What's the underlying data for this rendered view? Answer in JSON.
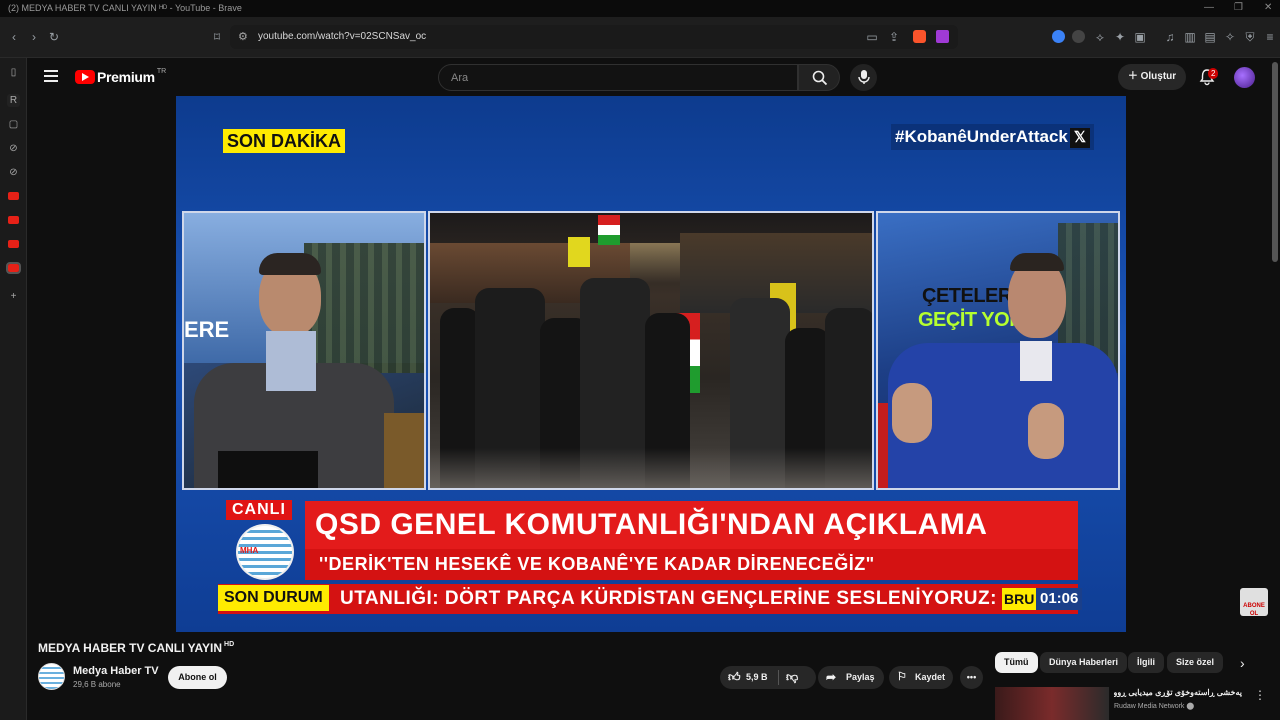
{
  "window": {
    "title": "(2) MEDYA HABER TV CANLI YAYIN ᴴᴰ - YouTube - Brave"
  },
  "browser": {
    "url": "youtube.com/watch?v=02SCNSav_oc"
  },
  "youtube": {
    "brand": "Premium",
    "region": "TR",
    "search_placeholder": "Ara",
    "create_label": "Oluştur",
    "notifications_count": "2"
  },
  "video_overlay": {
    "breaking": "SON DAKİKA",
    "hashtag": "#KobanêUnderAttack",
    "x_logo": "𝕏",
    "slogan_left": "ERE",
    "slogan_right_1": "ÇETELERE",
    "slogan_right_2": "GEÇİT YOK",
    "live_label": "CANLI",
    "channel_logo_text": "MHA",
    "headline": "QSD GENEL KOMUTANLIĞI'NDAN AÇIKLAMA",
    "subheadline": "''DERİK'TEN HESEKÊ VE KOBANÊ'YE KADAR DİRENECEĞİZ\"",
    "status_label": "SON DURUM",
    "ticker": "UTANLIĞI: DÖRT PARÇA KÜRDİSTAN GENÇLERİNE SESLENİYORUZ: SIN",
    "city": "BRU",
    "time": "01:06",
    "subscribe_logo": "ABONE OL"
  },
  "video_info": {
    "title": "MEDYA HABER TV CANLI YAYIN",
    "hd": "HD",
    "channel_name": "Medya Haber TV",
    "subscribers": "29,6 B abone",
    "subscribe_label": "Abone ol",
    "likes": "5,9 B",
    "share_label": "Paylaş",
    "save_label": "Kaydet"
  },
  "chips": [
    "Tümü",
    "Dünya Haberleri",
    "İlgili",
    "Size özel"
  ],
  "recommendation": {
    "title": "پەخشی ڕاستەوخۆی تۆڕی میدیایی ڕووداو",
    "meta": "Rudaw Media Network ⬤"
  },
  "colors": {
    "breaking_yellow": "#ffeb00",
    "headline_red": "#e31b1b",
    "video_blue": "#1a54b8",
    "youtube_red": "#ff0000"
  }
}
